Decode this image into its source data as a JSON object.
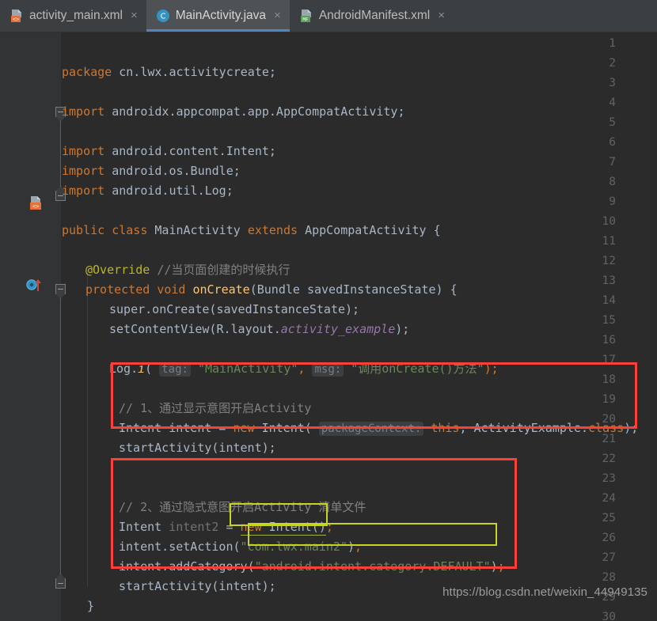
{
  "window": {
    "theme": "darcula",
    "accent_blue": "#4a88c7",
    "background": "#2b2b2b",
    "gutter_background": "#313335"
  },
  "tabs": [
    {
      "label": "activity_main.xml",
      "icon": "android-layout-xml-icon",
      "active": false,
      "close": "×"
    },
    {
      "label": "MainActivity.java",
      "icon": "java-class-icon",
      "active": true,
      "close": "×"
    },
    {
      "label": "AndroidManifest.xml",
      "icon": "android-manifest-icon",
      "active": false,
      "close": "×"
    }
  ],
  "gutter": {
    "line_numbers": [
      "1",
      "2",
      "3",
      "4",
      "5",
      "6",
      "7",
      "8",
      "9",
      "10",
      "11",
      "12",
      "13",
      "14",
      "15",
      "16",
      "17",
      "18",
      "19",
      "20",
      "21",
      "22",
      "23",
      "24",
      "25",
      "26",
      "27",
      "28",
      "29",
      "30"
    ],
    "markers": [
      {
        "line": 9,
        "type": "android-resource-icon"
      },
      {
        "line": 12,
        "type": "override-method-icon"
      }
    ]
  },
  "code": {
    "lines": [
      {
        "n": 1,
        "text": "package cn.lwx.activitycreate;"
      },
      {
        "n": 2,
        "text": ""
      },
      {
        "n": 3,
        "text": "import androidx.appcompat.app.AppCompatActivity;"
      },
      {
        "n": 4,
        "text": ""
      },
      {
        "n": 5,
        "text": "import android.content.Intent;"
      },
      {
        "n": 6,
        "text": "import android.os.Bundle;"
      },
      {
        "n": 7,
        "text": "import android.util.Log;"
      },
      {
        "n": 8,
        "text": ""
      },
      {
        "n": 9,
        "text": "public class MainActivity extends AppCompatActivity {"
      },
      {
        "n": 10,
        "text": ""
      },
      {
        "n": 11,
        "text": "    @Override //当页面创建的时候执行"
      },
      {
        "n": 12,
        "text": "    protected void onCreate(Bundle savedInstanceState) {"
      },
      {
        "n": 13,
        "text": "        super.onCreate(savedInstanceState);"
      },
      {
        "n": 14,
        "text": "        setContentView(R.layout.activity_example);"
      },
      {
        "n": 15,
        "text": ""
      },
      {
        "n": 16,
        "text": "        Log.i( tag: \"MainActivity\", msg: \"调用onCreate()方法\");"
      },
      {
        "n": 17,
        "text": ""
      },
      {
        "n": 18,
        "text": "        // 1、通过显示意图开启Activity"
      },
      {
        "n": 19,
        "text": "        Intent intent = new Intent( packageContext: this, ActivityExample.class);"
      },
      {
        "n": 20,
        "text": "        startActivity(intent);"
      },
      {
        "n": 21,
        "text": ""
      },
      {
        "n": 22,
        "text": ""
      },
      {
        "n": 23,
        "text": "        // 2、通过隐式意图开启Activity 清单文件"
      },
      {
        "n": 24,
        "text": "        Intent intent2 = new Intent();"
      },
      {
        "n": 25,
        "text": "        intent.setAction(\"com.lwx.main2\");"
      },
      {
        "n": 26,
        "text": "        intent.addCategory(\"android.intent.category.DEFAULT\");"
      },
      {
        "n": 27,
        "text": "        startActivity(intent);"
      },
      {
        "n": 28,
        "text": "    }"
      },
      {
        "n": 29,
        "text": ""
      },
      {
        "n": 30,
        "text": ""
      }
    ],
    "tokens": {
      "kw_package": "package",
      "pkg_name": " cn.lwx.activitycreate;",
      "kw_import": "import",
      "imp_appcompat": " androidx.appcompat.app.AppCompatActivity;",
      "imp_intent": " android.content.Intent;",
      "imp_bundle": " android.os.Bundle;",
      "imp_log": " android.util.Log;",
      "kw_public": "public",
      "kw_class": "class",
      "cls_mainactivity": "MainActivity",
      "kw_extends": "extends",
      "cls_appcompat": "AppCompatActivity {",
      "anno_override": "@Override",
      "cmt_override": "//当页面创建的时候执行",
      "kw_protected": "protected",
      "kw_void": "void",
      "mth_oncreate": "onCreate",
      "sig_oncreate": "(Bundle savedInstanceState) {",
      "super_call": "super.onCreate(savedInstanceState);",
      "setcontentview_pre": "setContentView(R.layout.",
      "setcontentview_field": "activity_example",
      "setcontentview_post": ");",
      "log_pre": "Log.",
      "log_i": "i",
      "log_paren": "( ",
      "hint_tag": "tag:",
      "log_tag_str": "\"MainActivity\"",
      "log_comma": ",",
      "hint_msg": "msg:",
      "log_msg_str": "\"调用onCreate()方法\"",
      "log_end": ");",
      "cmt_1": "// 1、通过显示意图开启Activity",
      "intent_decl": "Intent intent = ",
      "kw_new": "new",
      "intent_ctor": " Intent( ",
      "hint_pkgctx": "packageContext:",
      "kw_this": "this",
      "intent_arg2": ", ActivityExample.",
      "kw_class2": "class",
      "intent_close": ");",
      "start_activity": "startActivity(intent);",
      "cmt_2": "// 2、通过隐式意图开启Activity 清单文件",
      "intent2_decl": "Intent ",
      "intent2_var": "intent2",
      "intent2_eq": " = ",
      "intent2_new": "new",
      "intent2_ctor": " Intent()",
      "semi": ";",
      "setaction_pre": "intent.setAction",
      "setaction_open": "(",
      "setaction_str": "\"com.lwx.main2\"",
      "setaction_close": ")",
      "addcategory_pre": "intent.addCategory",
      "addcategory_open": "(",
      "addcategory_str": "\"android.intent.category.DEFAULT\"",
      "addcategory_close": ")",
      "close_brace": "}"
    }
  },
  "annotations": {
    "red_boxes": [
      {
        "label": "explicit-intent-highlight"
      },
      {
        "label": "implicit-intent-highlight"
      }
    ],
    "green_boxes": [
      {
        "label": "set-action-string-highlight"
      },
      {
        "label": "add-category-string-highlight"
      }
    ],
    "red_color": "#fc3f37",
    "green_color": "#c6d520"
  },
  "watermark": {
    "text": "https://blog.csdn.net/weixin_44949135"
  }
}
